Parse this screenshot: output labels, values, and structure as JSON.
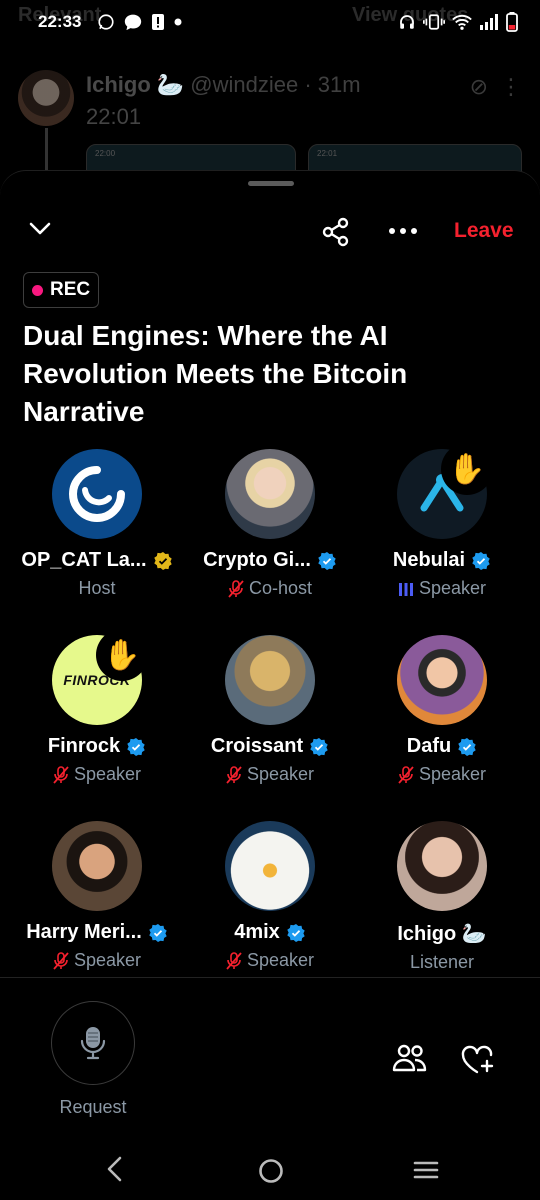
{
  "status_bar": {
    "time": "22:33",
    "left_icons": [
      "whatsapp-icon",
      "message-icon",
      "alert-icon",
      "dot-icon"
    ],
    "right_icons": [
      "headphones-icon",
      "vibrate-icon",
      "wifi-icon",
      "signal-icon",
      "battery-icon"
    ]
  },
  "background": {
    "left_tab": "Relevant",
    "right_tab": "View quotes",
    "tweet": {
      "name": "Ichigo 🦢",
      "handle": "@windziee · 31m",
      "text": "22:01",
      "thumb_left_time": "22:00",
      "thumb_right_time": "22:01"
    }
  },
  "header": {
    "leave_label": "Leave",
    "rec_label": "REC",
    "title": "Dual Engines: Where the AI Revolution Meets the Bitcoin Narrative"
  },
  "participants": [
    {
      "name": "OP_CAT La...",
      "role": "Host",
      "verified": "gold",
      "mic": "none",
      "hand": false
    },
    {
      "name": "Crypto Gi...",
      "role": "Co-host",
      "verified": "blue",
      "mic": "muted",
      "hand": false
    },
    {
      "name": "Nebulai",
      "role": "Speaker",
      "verified": "blue",
      "mic": "speaking",
      "hand": true
    },
    {
      "name": "Finrock",
      "role": "Speaker",
      "verified": "blue",
      "mic": "muted",
      "hand": true
    },
    {
      "name": "Croissant",
      "role": "Speaker",
      "verified": "blue",
      "mic": "muted",
      "hand": false
    },
    {
      "name": "Dafu",
      "role": "Speaker",
      "verified": "blue",
      "mic": "muted",
      "hand": false
    },
    {
      "name": "Harry Meri...",
      "role": "Speaker",
      "verified": "blue",
      "mic": "muted",
      "hand": false
    },
    {
      "name": "4mix",
      "role": "Speaker",
      "verified": "blue",
      "mic": "muted",
      "hand": false
    },
    {
      "name": "Ichigo 🦢",
      "role": "Listener",
      "verified": "none",
      "mic": "none",
      "hand": false
    }
  ],
  "avatar_logo_text": "FINROCK",
  "bottom_bar": {
    "request_label": "Request"
  },
  "colors": {
    "leave": "#f4212e",
    "rec_dot": "#f91880",
    "verified_blue": "#1d9bf0",
    "verified_gold": "#e2b719",
    "muted": "#f4212e",
    "speaking": "#4c5cf5",
    "secondary_text": "#8b98a5"
  }
}
